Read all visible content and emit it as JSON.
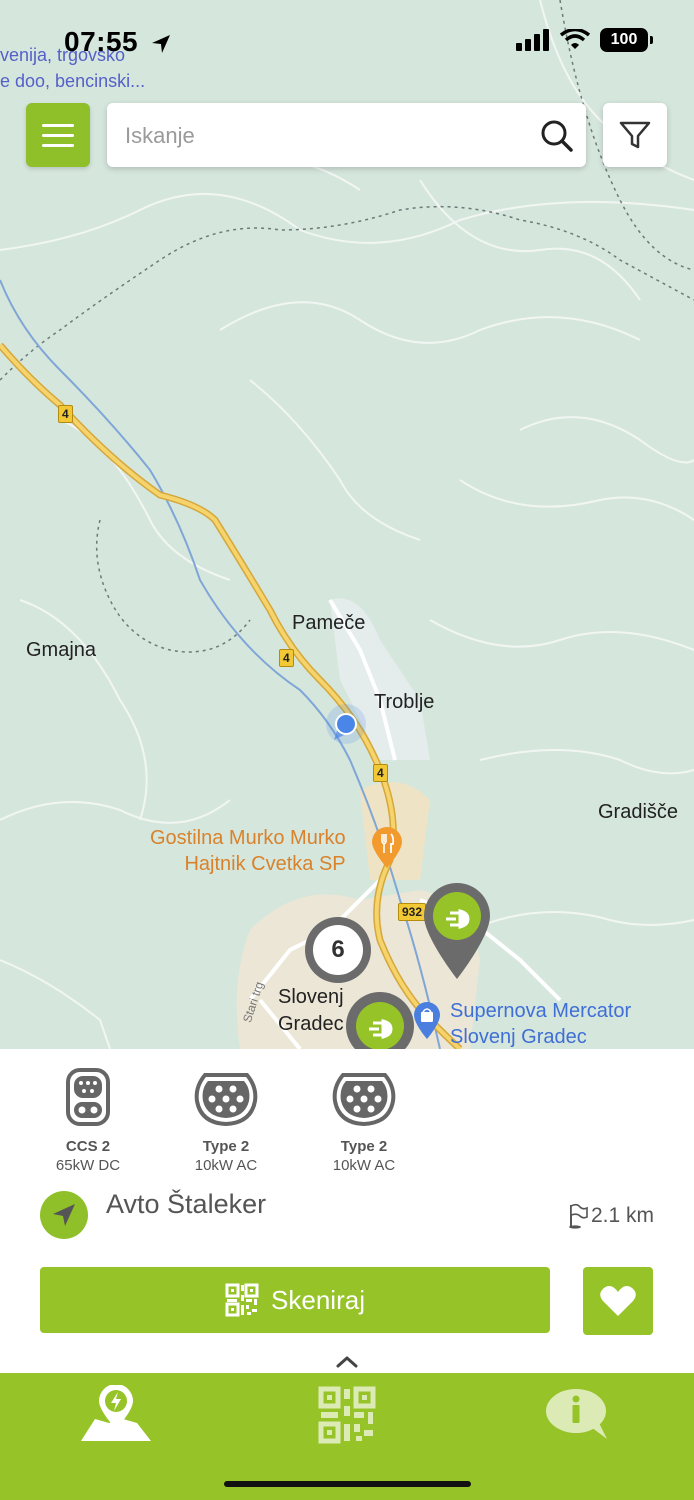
{
  "status_bar": {
    "time": "07:55",
    "battery": "100"
  },
  "map": {
    "overlay_text": [
      "venija, trgovsko",
      "e doo, bencinski..."
    ],
    "places": {
      "pameche": "Pameče",
      "troblje": "Troblje",
      "gmajna": "Gmajna",
      "gradisce": "Gradišče",
      "slovenj_gradec_line1": "Slovenj",
      "slovenj_gradec_line2": "Gradec",
      "stari_trg": "Stari trg"
    },
    "poi_restaurant": [
      "Gostilna Murko Murko",
      "Hajtnik Cvetka SP"
    ],
    "poi_store": [
      "Supernova Mercator",
      "Slovenj Gradec"
    ],
    "road_shields": [
      "4",
      "4",
      "4",
      "932"
    ],
    "cluster_count": "6"
  },
  "search": {
    "placeholder": "Iskanje"
  },
  "station": {
    "connectors": [
      {
        "type": "CCS 2",
        "spec": "65kW DC"
      },
      {
        "type": "Type 2",
        "spec": "10kW AC"
      },
      {
        "type": "Type 2",
        "spec": "10kW AC"
      }
    ],
    "name": "Avto Štaleker",
    "distance": "2.1 km",
    "scan_label": "Skeniraj"
  },
  "colors": {
    "brand_green": "#96c428",
    "map_bg": "#d5e6dd",
    "marker_gray": "#6b6b6b"
  }
}
